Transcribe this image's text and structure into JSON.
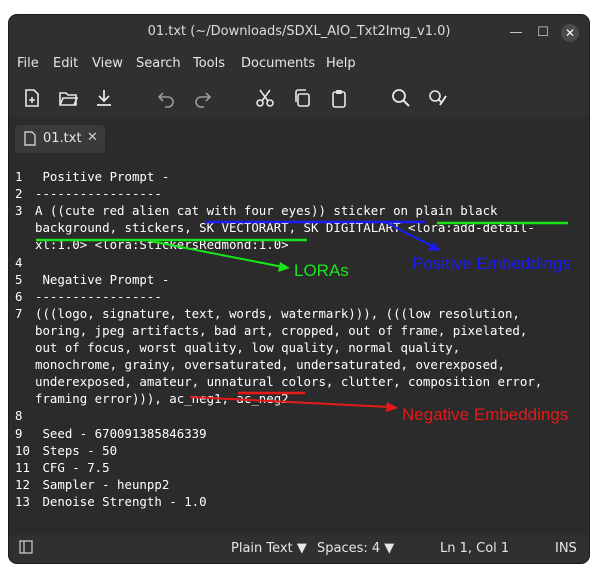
{
  "window": {
    "title": "01.txt (~/Downloads/SDXL_AIO_Txt2Img_v1.0)",
    "controls": {
      "minimize": "—",
      "maximize": "☐",
      "close": "✕"
    }
  },
  "menu": [
    "File",
    "Edit",
    "View",
    "Search",
    "Tools",
    "Documents",
    "Help"
  ],
  "toolbar": {
    "new": "new-document-icon",
    "open": "open-folder-icon",
    "save": "download-save-icon",
    "undo": "undo-icon",
    "redo": "redo-icon",
    "cut": "scissors-icon",
    "copy": "copy-icon",
    "paste": "clipboard-icon",
    "find": "search-icon",
    "replace": "find-replace-icon"
  },
  "tab": {
    "label": "01.txt",
    "close": "✕"
  },
  "editor": {
    "lines": [
      {
        "n": "1",
        "t": " Positive Prompt -"
      },
      {
        "n": "2",
        "t": "-----------------"
      },
      {
        "n": "3",
        "t": "A ((cute red alien cat with four eyes)) sticker on plain black"
      },
      {
        "n": "",
        "t": "background, stickers, SK VECTORART, SK DIGITALART <lora:add-detail-"
      },
      {
        "n": "",
        "t": "xl:1.0> <lora:StickersRedmond:1.0>"
      },
      {
        "n": "4",
        "t": ""
      },
      {
        "n": "5",
        "t": " Negative Prompt -"
      },
      {
        "n": "6",
        "t": "-----------------"
      },
      {
        "n": "7",
        "t": "(((logo, signature, text, words, watermark))), (((low resolution,"
      },
      {
        "n": "",
        "t": "boring, jpeg artifacts, bad art, cropped, out of frame, pixelated,"
      },
      {
        "n": "",
        "t": "out of focus, worst quality, low quality, normal quality,"
      },
      {
        "n": "",
        "t": "monochrome, grainy, oversaturated, undersaturated, overexposed,"
      },
      {
        "n": "",
        "t": "underexposed, amateur, unnatural colors, clutter, composition error,"
      },
      {
        "n": "",
        "t": "framing error))), ac_neg1, ac_neg2"
      },
      {
        "n": "8",
        "t": ""
      },
      {
        "n": "9",
        "t": " Seed - 670091385846339"
      },
      {
        "n": "10",
        "t": " Steps - 50"
      },
      {
        "n": "11",
        "t": " CFG - 7.5"
      },
      {
        "n": "12",
        "t": " Sampler - heunpp2"
      },
      {
        "n": "13",
        "t": " Denoise Strength - 1.0"
      }
    ]
  },
  "annotations": {
    "loras": {
      "label": "LORAs",
      "color": "#19e619"
    },
    "positive": {
      "label": "Positive Embeddings",
      "color": "#1a1aff"
    },
    "negative": {
      "label": "Negative Embeddings",
      "color": "#e61919"
    }
  },
  "statusbar": {
    "language": "Plain Text",
    "spaces": "Spaces: 4",
    "position": "Ln 1, Col 1",
    "mode": "INS"
  }
}
